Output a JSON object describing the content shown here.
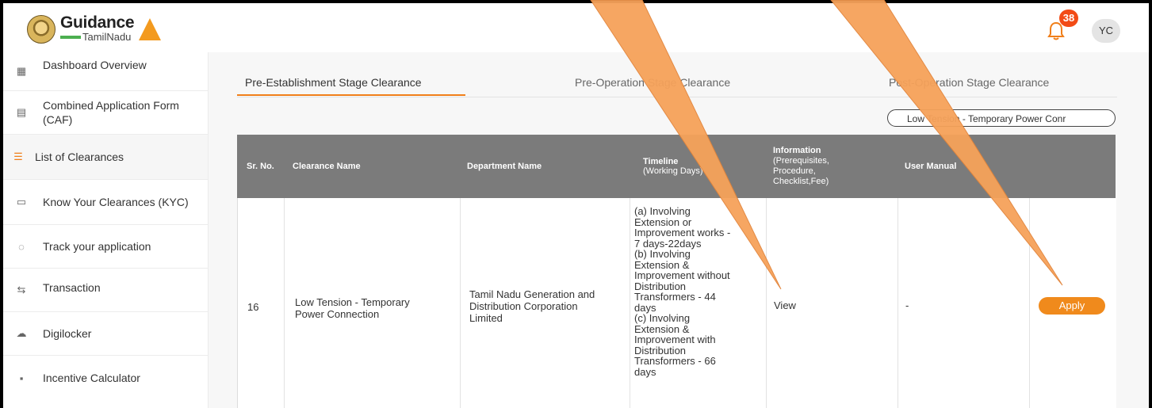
{
  "header": {
    "brand_name": "Guidance",
    "brand_sub": "TamilNadu",
    "notification_count": "38",
    "user_initials": "YC"
  },
  "sidebar": {
    "items": [
      {
        "label": "Dashboard Overview",
        "icon": "grid-icon"
      },
      {
        "label": "Combined Application Form (CAF)",
        "icon": "document-icon"
      },
      {
        "label": "List of Clearances",
        "icon": "list-icon"
      },
      {
        "label": "Know Your Clearances (KYC)",
        "icon": "id-card-icon"
      },
      {
        "label": "Track your application",
        "icon": "location-icon"
      },
      {
        "label": "Transaction",
        "icon": "transaction-icon"
      },
      {
        "label": "Digilocker",
        "icon": "cloud-icon"
      },
      {
        "label": "Incentive Calculator",
        "icon": "calculator-icon"
      }
    ]
  },
  "tabs": [
    {
      "label": "Pre-Establishment Stage Clearance"
    },
    {
      "label": "Pre-Operation Stage Clearance"
    },
    {
      "label": "Post-Operation Stage Clearance"
    }
  ],
  "search": {
    "value": "Low Tension - Temporary Power Conr"
  },
  "table": {
    "headers": {
      "sr_no": "Sr. No.",
      "clearance_name": "Clearance Name",
      "department_name": "Department Name",
      "timeline_1": "Timeline",
      "timeline_2": "(Working Days)",
      "information_1": "Information",
      "information_2": "(Prerequisites,",
      "information_3": "Procedure,",
      "information_4": "Checklist,Fee)",
      "user_manual": "User Manual"
    },
    "row": {
      "sr_no": "16",
      "clearance_name_1": "Low Tension - Temporary",
      "clearance_name_2": "Power Connection",
      "department_1": "Tamil Nadu Generation and",
      "department_2": "Distribution Corporation",
      "department_3": "Limited",
      "timeline_lines": [
        "(a) Involving",
        "Extension or",
        "Improvement works -",
        "7 days-22days",
        "(b) Involving",
        "Extension &",
        "Improvement without",
        "Distribution",
        "Transformers - 44",
        "days",
        "(c) Involving",
        "Extension &",
        "Improvement with",
        "Distribution",
        "Transformers - 66",
        "days"
      ],
      "information": "View",
      "user_manual": "-",
      "action": "Apply"
    }
  },
  "colors": {
    "accent": "#f07f1a",
    "header_bg": "#7b7b7b",
    "badge": "#f24b16",
    "pointer": "#f6a25a"
  }
}
